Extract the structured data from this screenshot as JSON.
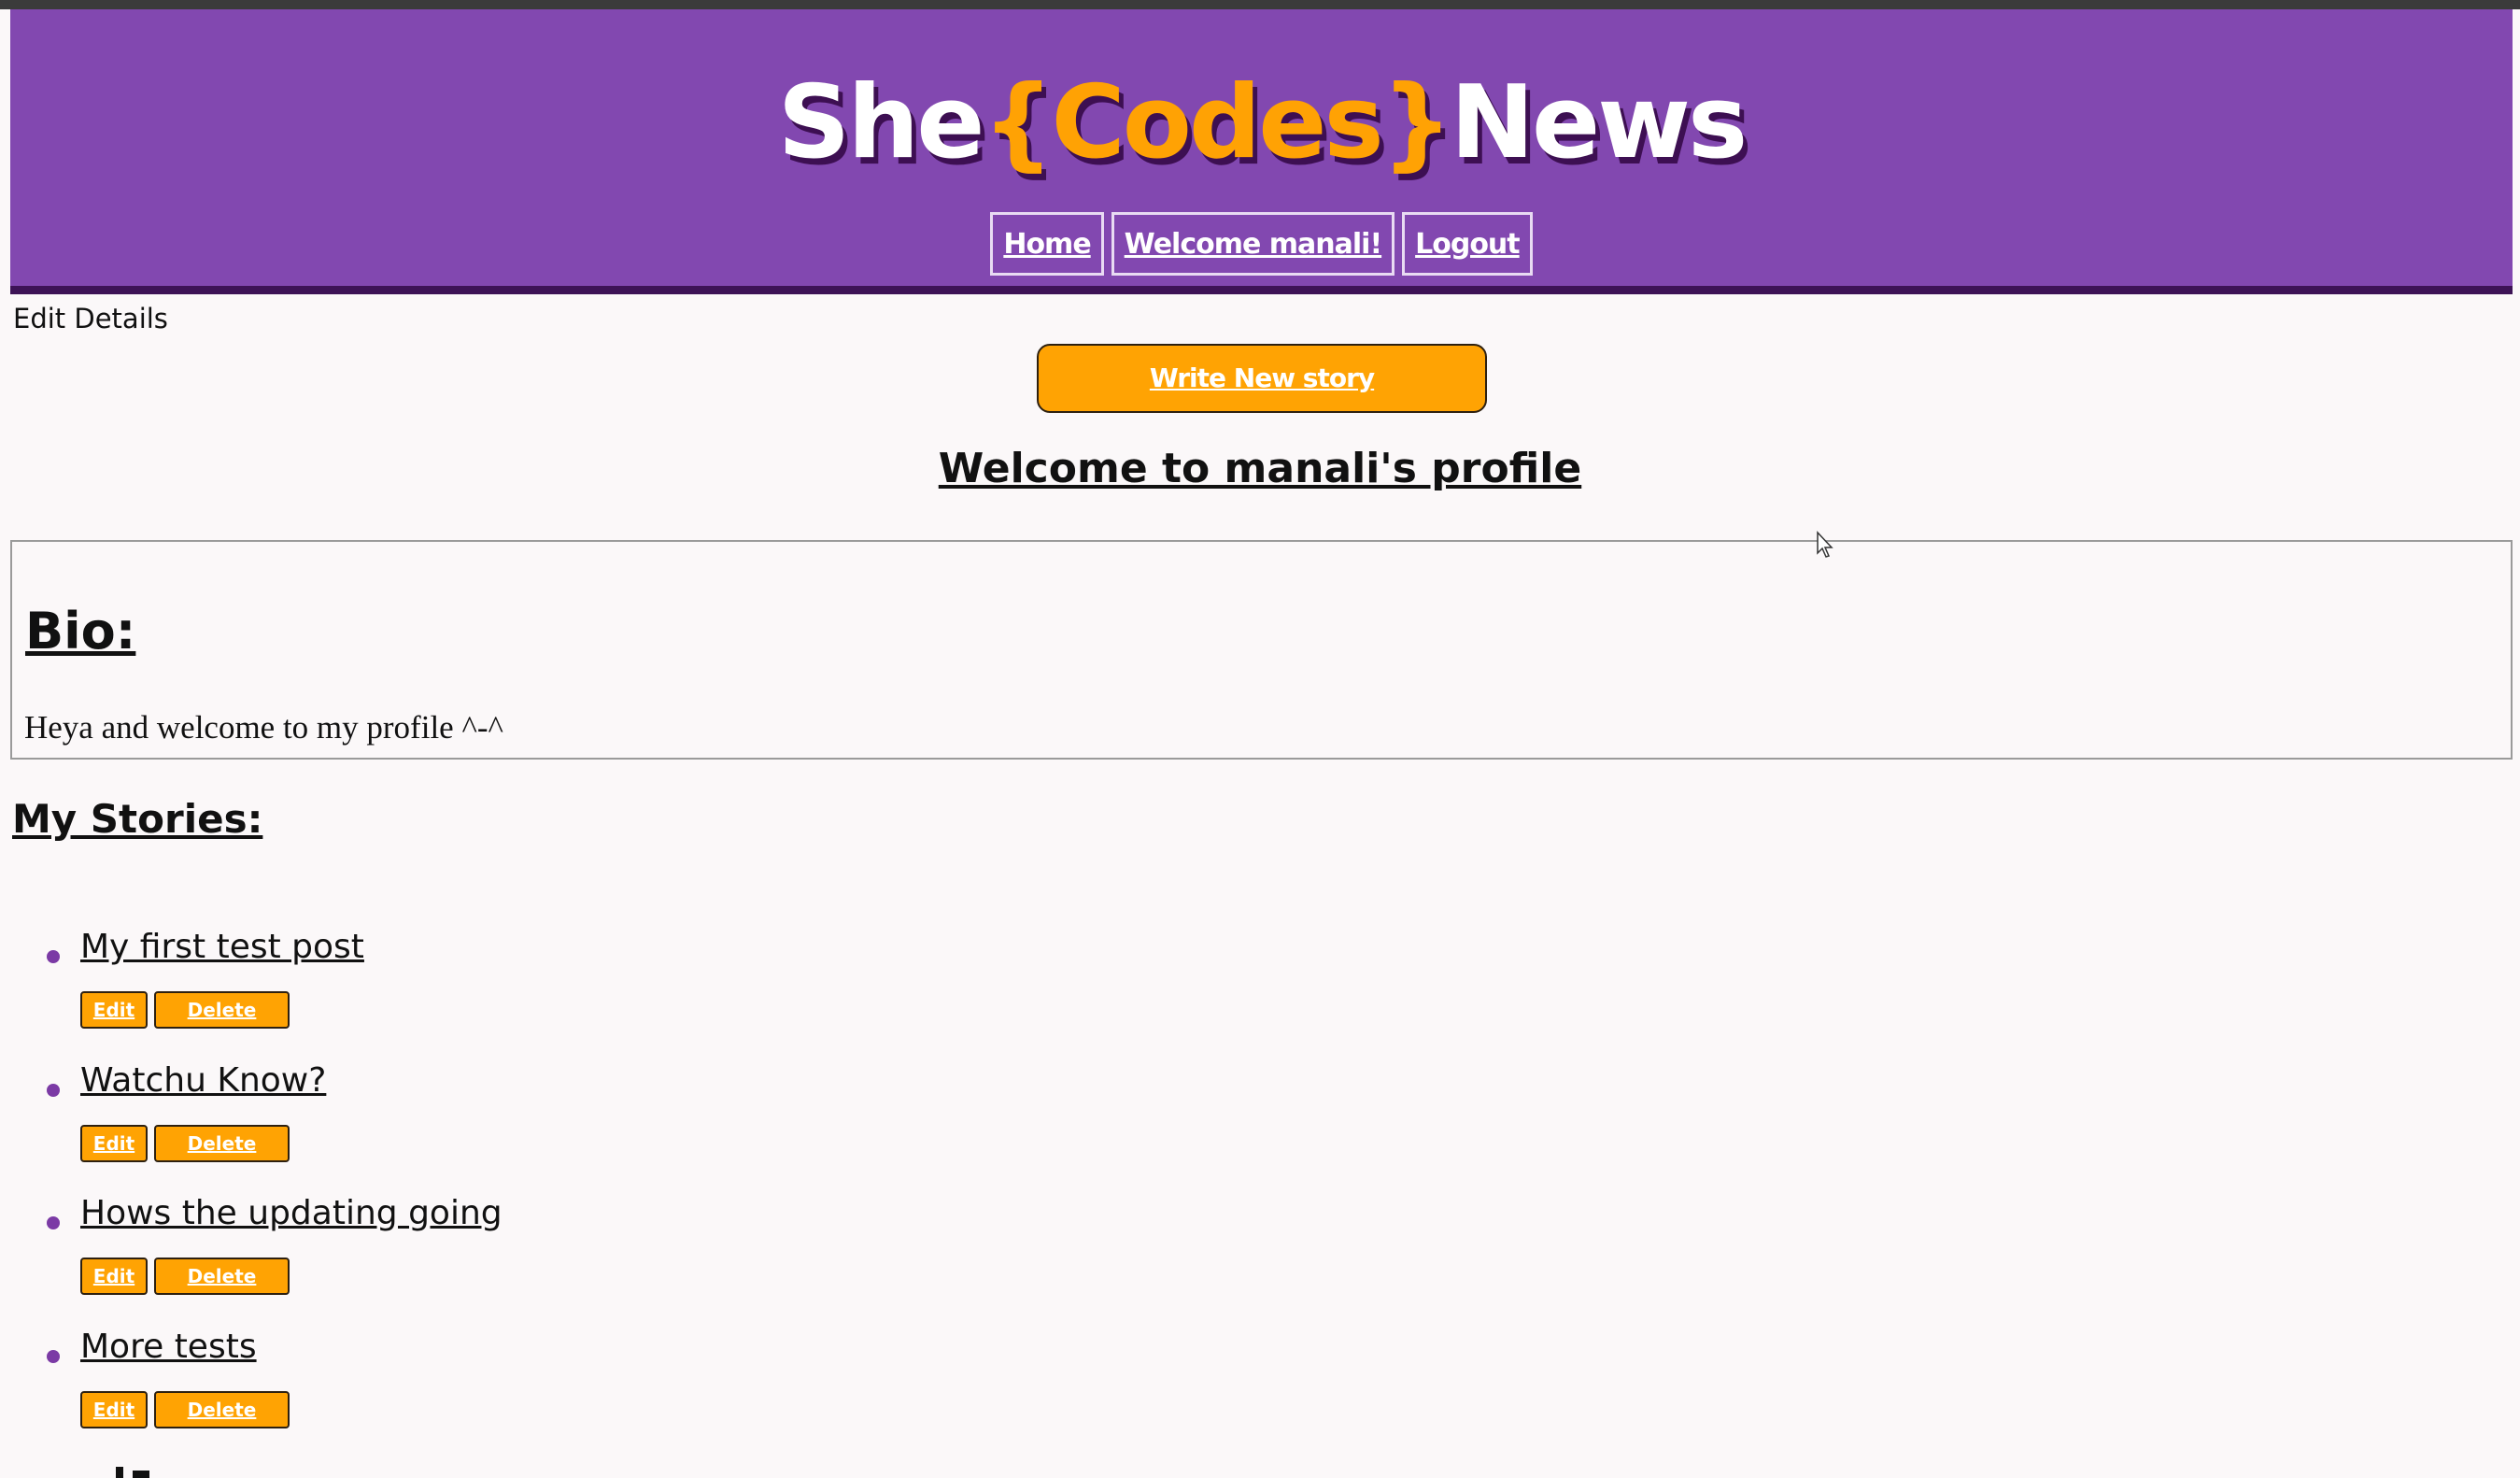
{
  "header": {
    "logo": {
      "part1": "She",
      "brace_open": "{",
      "part2": "Codes",
      "brace_close": "}",
      "part3": "News"
    },
    "nav": {
      "home": "Home",
      "welcome": "Welcome manali!",
      "logout": "Logout"
    }
  },
  "main": {
    "edit_details": "Edit Details",
    "write_button": "Write New story",
    "profile_title": "Welcome to manali's profile",
    "bio": {
      "heading": "Bio:",
      "text": "Heya and welcome to my profile ^-^"
    },
    "stories_heading": "My Stories:",
    "stories": [
      {
        "title": "My first test post",
        "edit": "Edit",
        "delete": "Delete"
      },
      {
        "title": "Watchu Know?",
        "edit": "Edit",
        "delete": "Delete"
      },
      {
        "title": "Hows the updating going",
        "edit": "Edit",
        "delete": "Delete"
      },
      {
        "title": "More tests",
        "edit": "Edit",
        "delete": "Delete"
      }
    ]
  },
  "colors": {
    "header_bg": "#8248b0",
    "header_border": "#3d1356",
    "accent_orange": "#ffa303",
    "bullet": "#7b3aa5"
  },
  "icons": {
    "cursor": "mouse-cursor-icon"
  }
}
